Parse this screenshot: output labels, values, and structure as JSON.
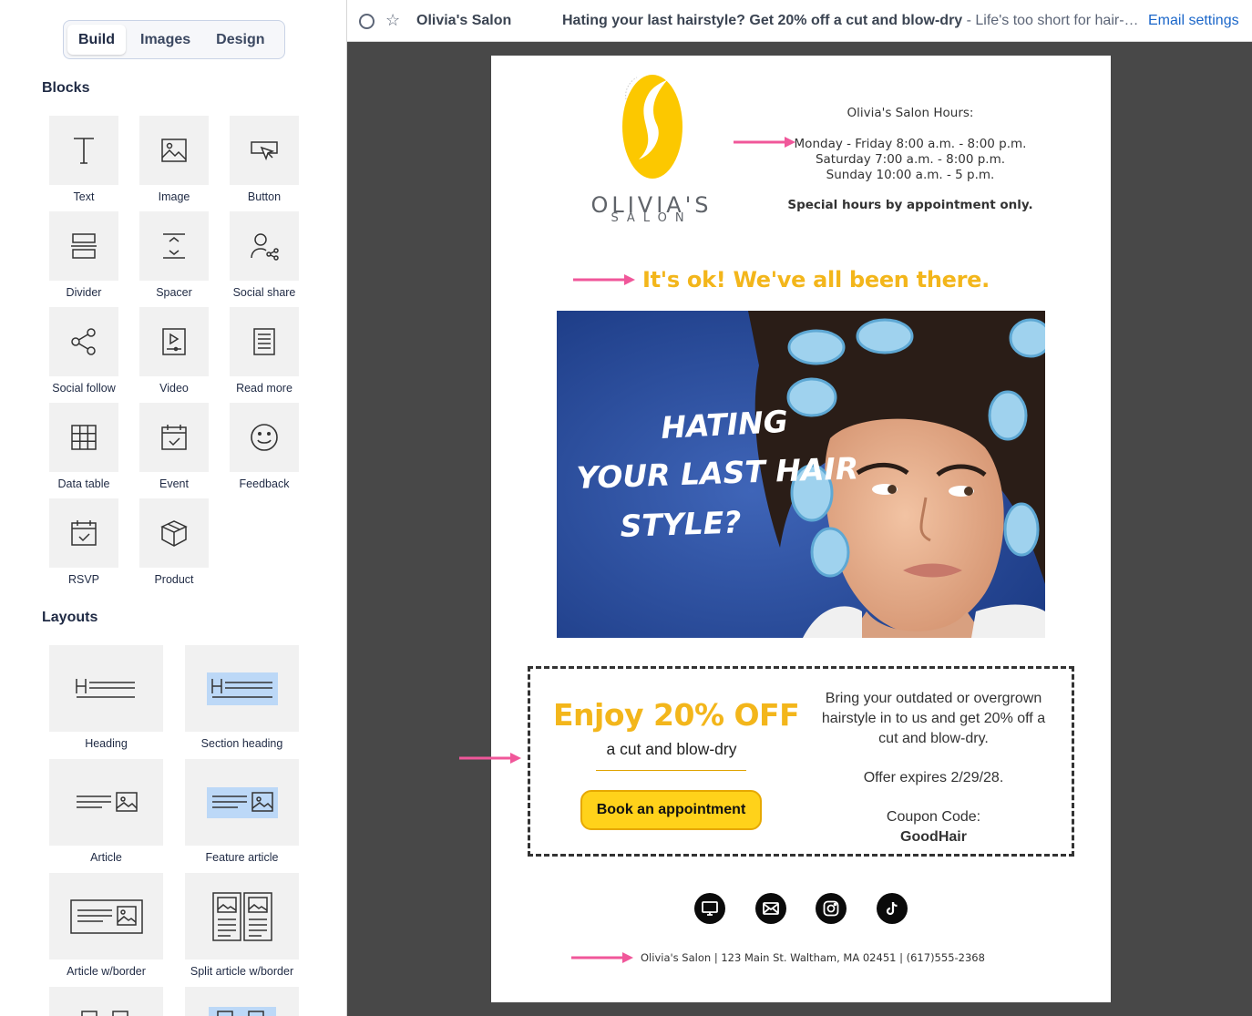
{
  "sidebar": {
    "tabs": [
      {
        "label": "Build",
        "active": true
      },
      {
        "label": "Images",
        "active": false
      },
      {
        "label": "Design",
        "active": false
      }
    ],
    "blocks_heading": "Blocks",
    "blocks": [
      {
        "label": "Text",
        "icon": "text-icon"
      },
      {
        "label": "Image",
        "icon": "image-icon"
      },
      {
        "label": "Button",
        "icon": "button-icon"
      },
      {
        "label": "Divider",
        "icon": "divider-icon"
      },
      {
        "label": "Spacer",
        "icon": "spacer-icon"
      },
      {
        "label": "Social share",
        "icon": "social-share-icon"
      },
      {
        "label": "Social follow",
        "icon": "social-follow-icon"
      },
      {
        "label": "Video",
        "icon": "video-icon"
      },
      {
        "label": "Read more",
        "icon": "read-more-icon"
      },
      {
        "label": "Data table",
        "icon": "data-table-icon"
      },
      {
        "label": "Event",
        "icon": "event-icon"
      },
      {
        "label": "Feedback",
        "icon": "feedback-icon"
      },
      {
        "label": "RSVP",
        "icon": "rsvp-icon"
      },
      {
        "label": "Product",
        "icon": "product-icon"
      }
    ],
    "layouts_heading": "Layouts",
    "layouts": [
      {
        "label": "Heading",
        "icon": "heading-layout-icon"
      },
      {
        "label": "Section heading",
        "icon": "section-heading-layout-icon"
      },
      {
        "label": "Article",
        "icon": "article-layout-icon"
      },
      {
        "label": "Feature article",
        "icon": "feature-article-layout-icon"
      },
      {
        "label": "Article w/border",
        "icon": "article-border-layout-icon"
      },
      {
        "label": "Split article w/border",
        "icon": "split-article-border-layout-icon"
      }
    ]
  },
  "topbar": {
    "sender": "Olivia's Salon",
    "subject": "Hating your last hairstyle? Get 20% off a cut and blow-dry",
    "preheader": " - Life's too short for hair-…",
    "email_settings": "Email settings"
  },
  "email": {
    "logo": {
      "name": "OLIVIA'S",
      "sub": "SALON"
    },
    "hours": {
      "title": "Olivia's Salon Hours:",
      "weekday": "Monday - Friday 8:00 a.m. - 8:00 p.m.",
      "saturday": "Saturday 7:00 a.m. - 8:00 p.m.",
      "sunday": "Sunday 10:00 a.m. - 5 p.m.",
      "special": "Special hours by appointment only."
    },
    "headline": "It's ok! We've all been there.",
    "hero_text": [
      "HATING",
      "YOUR LAST HAIR",
      "STYLE?"
    ],
    "promo": {
      "big": "Enjoy 20% OFF",
      "sub": "a cut and blow-dry",
      "button": "Book an appointment",
      "desc": "Bring your outdated or overgrown hairstyle in to us and get 20% off a cut and blow-dry.",
      "expires": "Offer expires 2/29/28.",
      "code_label": "Coupon Code:",
      "code": "GoodHair"
    },
    "social": [
      "website-icon",
      "email-icon",
      "instagram-icon",
      "tiktok-icon"
    ],
    "footer": "Olivia's Salon | 123 Main St. Waltham, MA 02451 | (617)555-2368"
  },
  "colors": {
    "brand_yellow": "#f3b61b",
    "button_yellow": "#ffd21a",
    "arrow_pink": "#f0579a",
    "canvas_bg": "#484848",
    "link_blue": "#1a66c9"
  }
}
